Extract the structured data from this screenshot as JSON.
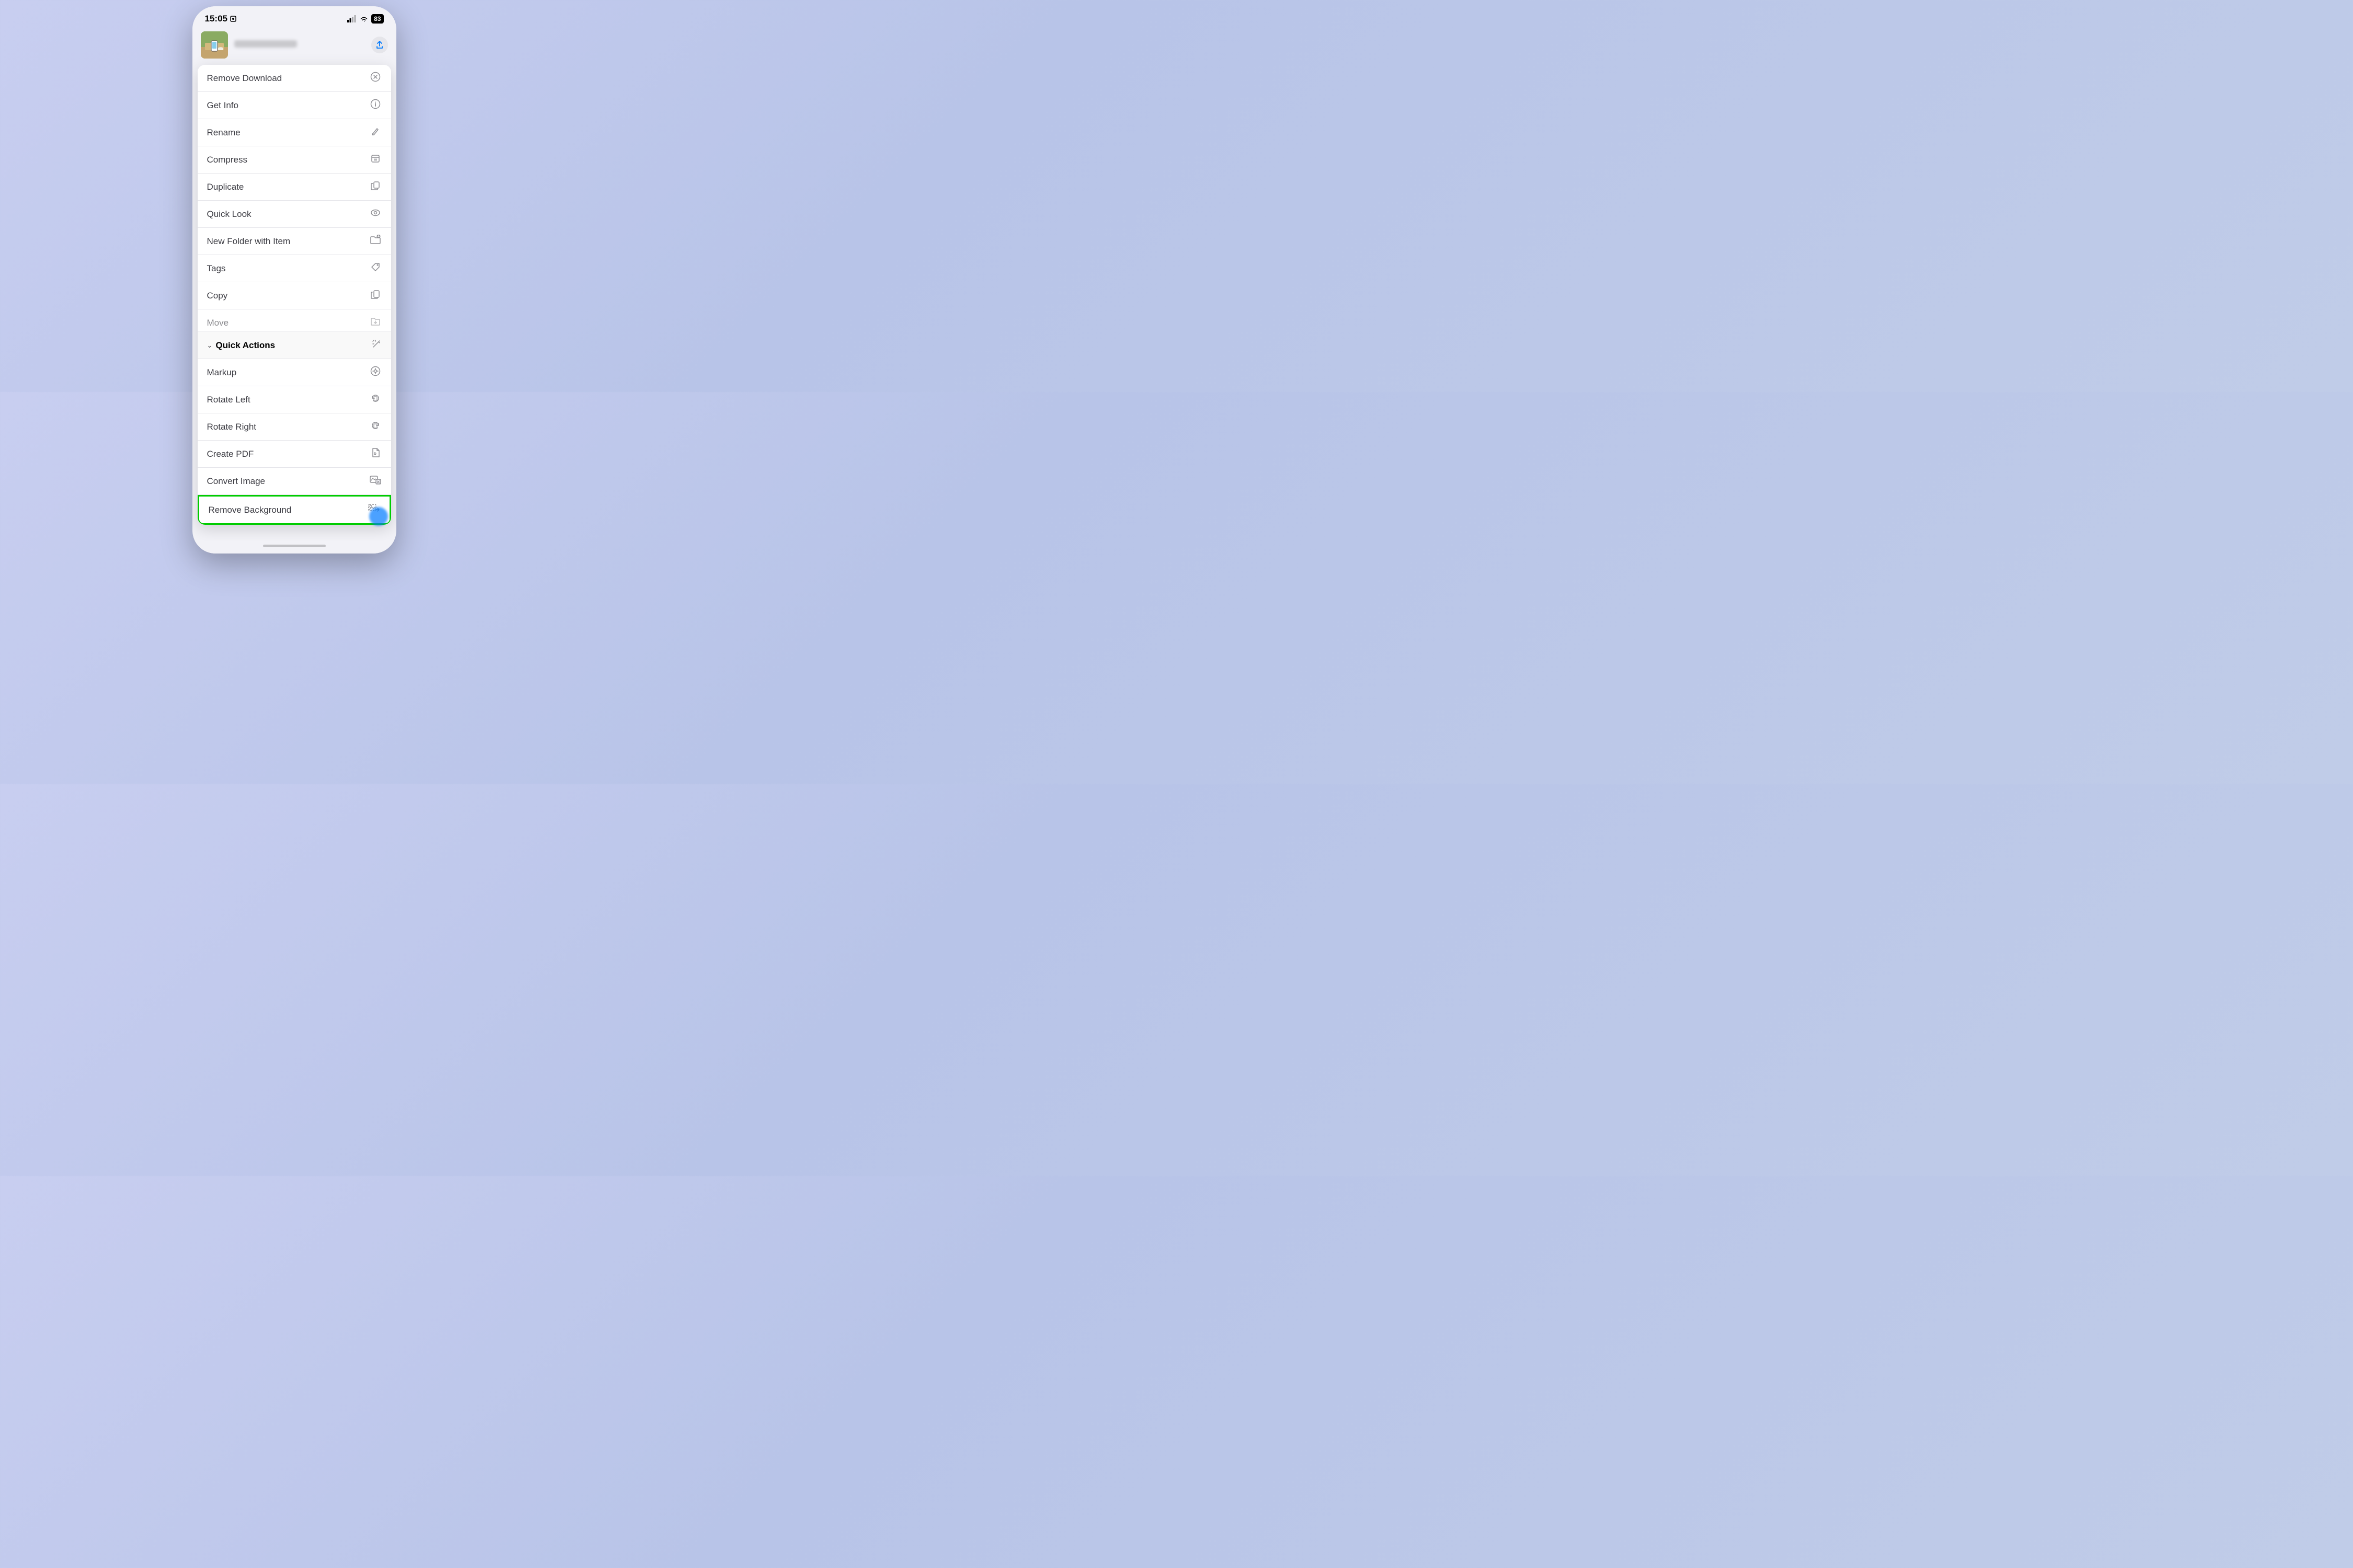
{
  "statusBar": {
    "time": "15:05",
    "batteryPercent": "83"
  },
  "header": {
    "ellipsisLabel": "•••"
  },
  "menuItems": [
    {
      "id": "remove-download",
      "label": "Remove Download",
      "icon": "circle-x"
    },
    {
      "id": "get-info",
      "label": "Get Info",
      "icon": "info-circle"
    },
    {
      "id": "rename",
      "label": "Rename",
      "icon": "pencil"
    },
    {
      "id": "compress",
      "label": "Compress",
      "icon": "archive"
    },
    {
      "id": "duplicate",
      "label": "Duplicate",
      "icon": "duplicate"
    },
    {
      "id": "quick-look",
      "label": "Quick Look",
      "icon": "eye"
    },
    {
      "id": "new-folder-with-item",
      "label": "New Folder with Item",
      "icon": "folder-badge"
    },
    {
      "id": "tags",
      "label": "Tags",
      "icon": "tag"
    },
    {
      "id": "copy",
      "label": "Copy",
      "icon": "copy"
    },
    {
      "id": "move",
      "label": "Move",
      "icon": "folder-open"
    }
  ],
  "quickActions": {
    "headerLabel": "Quick Actions",
    "items": [
      {
        "id": "markup",
        "label": "Markup",
        "icon": "markup"
      },
      {
        "id": "rotate-left",
        "label": "Rotate Left",
        "icon": "rotate-left"
      },
      {
        "id": "rotate-right",
        "label": "Rotate Right",
        "icon": "rotate-right"
      },
      {
        "id": "create-pdf",
        "label": "Create PDF",
        "icon": "pdf"
      },
      {
        "id": "convert-image",
        "label": "Convert Image",
        "icon": "convert-image"
      },
      {
        "id": "remove-background",
        "label": "Remove Background",
        "icon": "remove-bg"
      }
    ]
  }
}
